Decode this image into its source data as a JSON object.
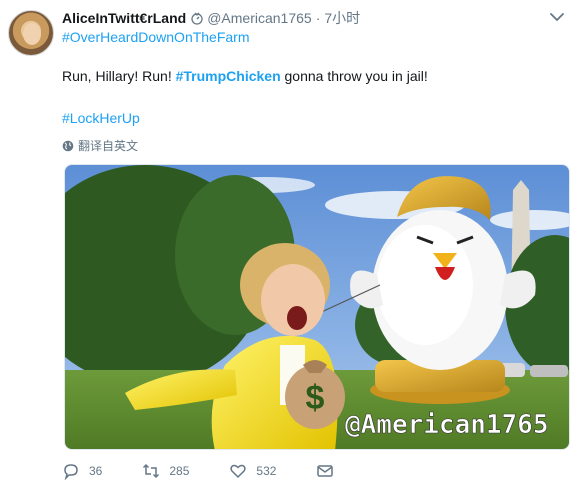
{
  "tweet": {
    "author_name": "AliceInTwitt€rLand",
    "handle": "@American1765",
    "separator": "·",
    "time": "7小时",
    "tagline": "#OverHeardDownOnTheFarm",
    "body_prefix": "Run, Hillary! Run! ",
    "body_hashtag": "#TrumpChicken",
    "body_suffix": " gonna throw you in jail!",
    "hashtag2": "#LockHerUp",
    "translate_label": "翻译自英文",
    "media_watermark": "@American1765",
    "money_bag_symbol": "$"
  },
  "actions": {
    "reply_count": "36",
    "retweet_count": "285",
    "like_count": "532"
  },
  "colors": {
    "link": "#1da1f2",
    "muted": "#657786",
    "text": "#14171a"
  },
  "icons": [
    "badge-icon",
    "chevron-down-icon",
    "globe-icon",
    "reply-icon",
    "retweet-icon",
    "like-icon",
    "message-icon"
  ]
}
